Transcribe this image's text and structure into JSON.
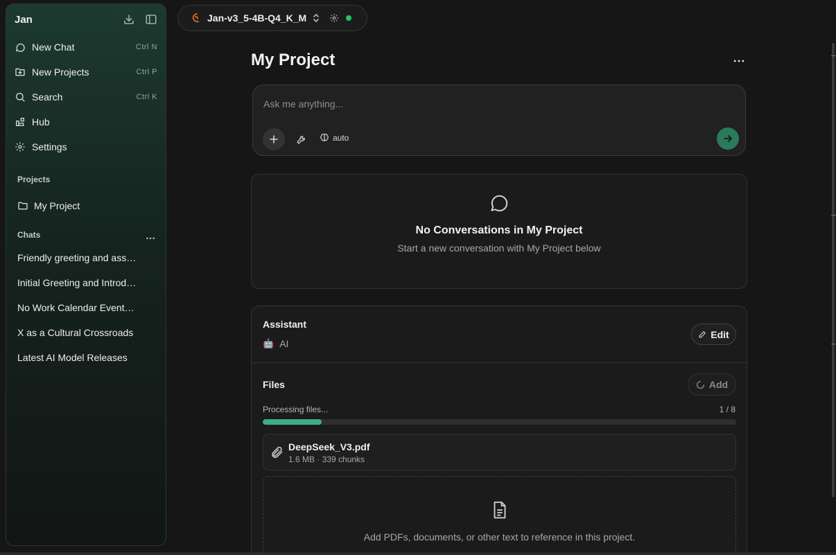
{
  "sidebar": {
    "title": "Jan",
    "nav": [
      {
        "label": "New Chat",
        "shortcut": "Ctrl N",
        "icon": "chat-bubble-icon"
      },
      {
        "label": "New Projects",
        "shortcut": "Ctrl P",
        "icon": "folder-plus-icon"
      },
      {
        "label": "Search",
        "shortcut": "Ctrl K",
        "icon": "search-icon"
      },
      {
        "label": "Hub",
        "shortcut": "",
        "icon": "blocks-icon"
      },
      {
        "label": "Settings",
        "shortcut": "",
        "icon": "gear-icon"
      }
    ],
    "projects_label": "Projects",
    "projects": [
      {
        "label": "My Project",
        "icon": "folder-icon"
      }
    ],
    "chats_label": "Chats",
    "chats": [
      "Friendly greeting and assistance offer",
      "Initial Greeting and Introduction",
      "No Work Calendar Events Found",
      "X as a Cultural Crossroads",
      "Latest AI Model Releases"
    ]
  },
  "model": {
    "name": "Jan-v3_5-4B-Q4_K_M",
    "status_color": "#22c55e"
  },
  "main": {
    "title": "My Project",
    "composer": {
      "placeholder": "Ask me anything...",
      "mode_label": "auto"
    },
    "empty": {
      "title": "No Conversations in My Project",
      "subtitle": "Start a new conversation with My Project below"
    },
    "assistant": {
      "label": "Assistant",
      "emoji": "🤖",
      "name": "AI",
      "edit_label": "Edit"
    },
    "files": {
      "label": "Files",
      "add_label": "Add",
      "processing_label": "Processing files...",
      "processing_count": "1 / 8",
      "progress_fraction": 0.125,
      "items": [
        {
          "name": "DeepSeek_V3.pdf",
          "meta": "1.6 MB · 339 chunks"
        }
      ],
      "drop_hint": "Add PDFs, documents, or other text to reference in this project."
    }
  },
  "colors": {
    "accent": "#2a7a5c",
    "progress": "#3fae86",
    "sidebar_top": "#1d3a30"
  }
}
